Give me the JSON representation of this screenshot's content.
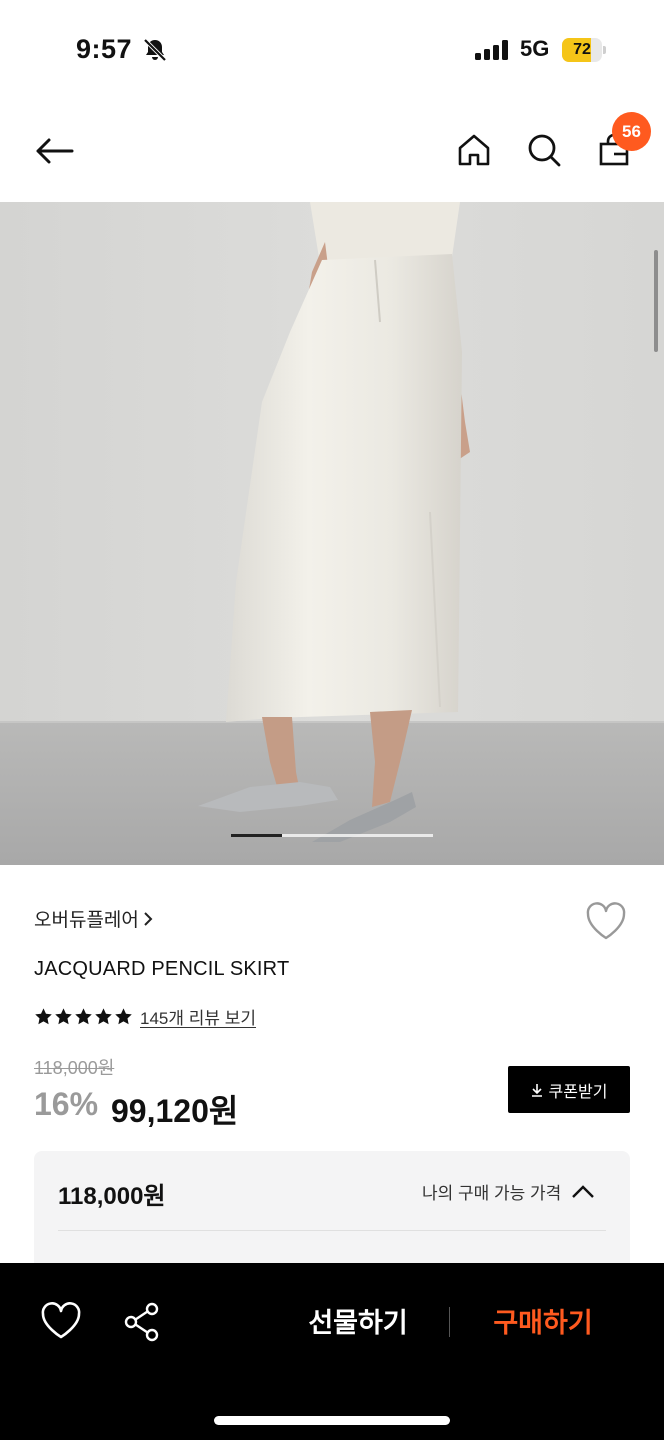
{
  "status_bar": {
    "time": "9:57",
    "network": "5G",
    "battery_level": 72,
    "battery_label": "72"
  },
  "nav": {
    "cart_count": "56",
    "icons": [
      "back-arrow-icon",
      "home-icon",
      "search-icon",
      "shopping-bag-icon"
    ]
  },
  "hero": {
    "image_count_hint": "product-photo",
    "carousel_progress": 0.25
  },
  "product": {
    "brand": "오버듀플레어",
    "name": "JACQUARD PENCIL SKIRT",
    "rating_stars": 5,
    "review_link": "145개 리뷰 보기",
    "original_price": "118,000원",
    "discount_rate": "16%",
    "sale_price": "99,120원",
    "coupon_label": "쿠폰받기"
  },
  "price_box": {
    "amount": "118,000원",
    "toggle_label": "나의 구매 가능 가격"
  },
  "bottom_bar": {
    "gift_label": "선물하기",
    "buy_label": "구매하기"
  },
  "colors": {
    "accent": "#ff5a1f",
    "battery": "#f5c518",
    "bottom_bar": "#000000"
  }
}
